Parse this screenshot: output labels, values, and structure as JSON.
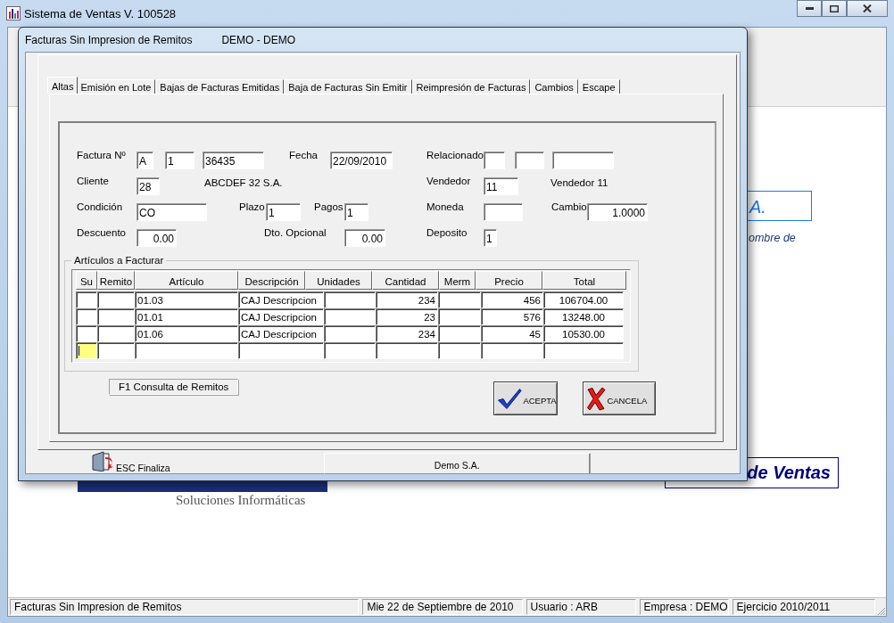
{
  "window": {
    "title": "Sistema de Ventas V. 100528"
  },
  "background": {
    "texts": [
      {
        "kind": "boxed",
        "text": "A."
      },
      {
        "kind": "italic",
        "text": "ombre de"
      },
      {
        "kind": "title",
        "text": "de Ventas"
      },
      {
        "kind": "tagline",
        "text": "Soluciones Informáticas"
      }
    ]
  },
  "dialog": {
    "title": "Facturas Sin Impresion de Remitos",
    "subtitle": "DEMO  - DEMO",
    "tabs": [
      {
        "label": "Altas",
        "selected": true
      },
      {
        "label": "Emisión en Lote",
        "selected": false
      },
      {
        "label": "Bajas de Facturas Emitidas",
        "selected": false
      },
      {
        "label": "Baja de Facturas Sin Emitir",
        "selected": false
      },
      {
        "label": "Reimpresión de Facturas",
        "selected": false
      },
      {
        "label": "Cambios",
        "selected": false
      },
      {
        "label": "Escape",
        "selected": false
      }
    ],
    "form": {
      "fields": [
        {
          "label": "Factura Nº",
          "inputs": [
            {
              "kind": "text",
              "value": "A"
            },
            {
              "kind": "text",
              "value": "1"
            },
            {
              "kind": "text",
              "value": "36435"
            }
          ]
        },
        {
          "label": "Fecha",
          "inputs": [
            {
              "kind": "text",
              "value": "22/09/2010"
            }
          ]
        },
        {
          "label": "Relacionado",
          "inputs": [
            {
              "kind": "text"
            },
            {
              "kind": "text"
            },
            {
              "kind": "text"
            }
          ]
        },
        {
          "label": "Cliente",
          "inputs": [
            {
              "kind": "text",
              "value": "28"
            }
          ],
          "note": "ABCDEF 32 S.A."
        },
        {
          "label": "Vendedor",
          "inputs": [
            {
              "kind": "text",
              "value": "11"
            }
          ],
          "note": "Vendedor 11"
        },
        {
          "label": "Condición",
          "inputs": [
            {
              "kind": "text",
              "value": "CO"
            }
          ]
        },
        {
          "label": "Plazo",
          "inputs": [
            {
              "kind": "text",
              "value": "1"
            }
          ]
        },
        {
          "label": "Pagos",
          "inputs": [
            {
              "kind": "text",
              "value": "1"
            }
          ]
        },
        {
          "label": "Moneda",
          "inputs": [
            {
              "kind": "text"
            }
          ]
        },
        {
          "label": "Cambio",
          "inputs": [
            {
              "kind": "number",
              "value": "1.0000"
            }
          ]
        },
        {
          "label": "Descuento",
          "inputs": [
            {
              "kind": "number",
              "value": "0.00"
            }
          ]
        },
        {
          "label": "Dto. Opcional",
          "inputs": [
            {
              "kind": "number",
              "value": "0.00"
            }
          ]
        },
        {
          "label": "Deposito",
          "inputs": [
            {
              "kind": "text",
              "value": "1"
            }
          ]
        }
      ]
    },
    "grid": {
      "title": "Artículos a Facturar",
      "columns": [
        "Su",
        "Remito",
        "Artículo",
        "Descripción",
        "Unidades",
        "Cantidad",
        "Merm",
        "Precio",
        "Total"
      ],
      "rows": [
        {
          "active": false,
          "cells": [
            "",
            "",
            "01.03",
            "CAJ Descripcion",
            "",
            "234",
            "",
            "456",
            "106704.00"
          ]
        },
        {
          "active": false,
          "cells": [
            "",
            "",
            "01.01",
            "CAJ Descripcion",
            "",
            "23",
            "",
            "576",
            "13248.00"
          ]
        },
        {
          "active": false,
          "cells": [
            "",
            "",
            "01.06",
            "CAJ Descripcion",
            "",
            "234",
            "",
            "45",
            "10530.00"
          ]
        },
        {
          "active": true,
          "cells": [
            "",
            "",
            "",
            "",
            "",
            "",
            "",
            "",
            ""
          ]
        }
      ]
    },
    "f1_button": "F1  Consulta de Remitos",
    "buttons": [
      {
        "kind": "accept",
        "label": "ACEPTA"
      },
      {
        "kind": "cancel",
        "label": "CANCELA"
      }
    ],
    "footer": {
      "hint": "ESC Finaliza",
      "company": "Demo S.A."
    }
  },
  "status_bar": [
    {
      "text": "Facturas Sin Impresion de Remitos"
    },
    {
      "text": "Mie 22 de Septiembre de 2010"
    },
    {
      "text": "Usuario : ARB"
    },
    {
      "text": "Empresa : DEMO"
    },
    {
      "text": "Ejercicio 2010/2011"
    }
  ]
}
